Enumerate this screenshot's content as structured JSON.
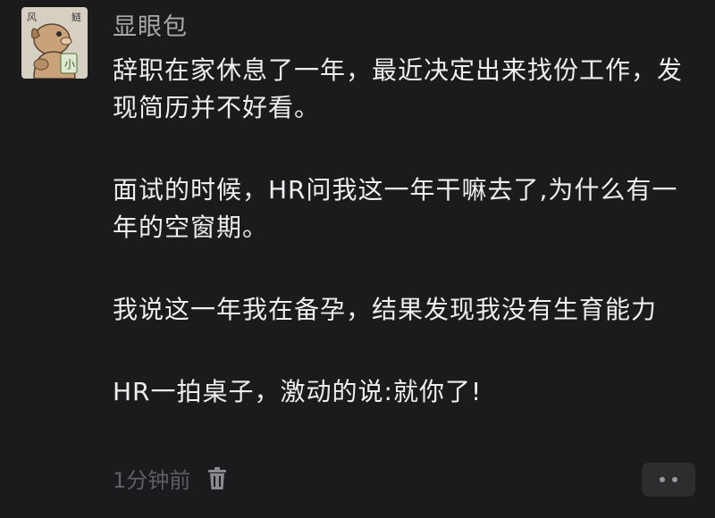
{
  "post": {
    "username": "显眼包",
    "paragraphs": [
      "辞职在家休息了一年，最近决定出来找份工作，发现简历并不好看。",
      "面试的时候，HR问我这一年干嘛去了,为什么有一年的空窗期。",
      "我说这一年我在备孕，结果发现我没有生育能力",
      "HR一拍桌子，激动的说:就你了!"
    ],
    "timestamp": "1分钟前",
    "avatar": {
      "corner_left": "风",
      "corner_right": "鲢",
      "badge_text": "小"
    }
  },
  "colors": {
    "background": "#1b1b1d",
    "text": "#eeeeee",
    "username": "#a9a9a9",
    "meta": "#5f5f63"
  },
  "icons": {
    "delete": "trash-icon",
    "more": "more-dots-icon"
  }
}
